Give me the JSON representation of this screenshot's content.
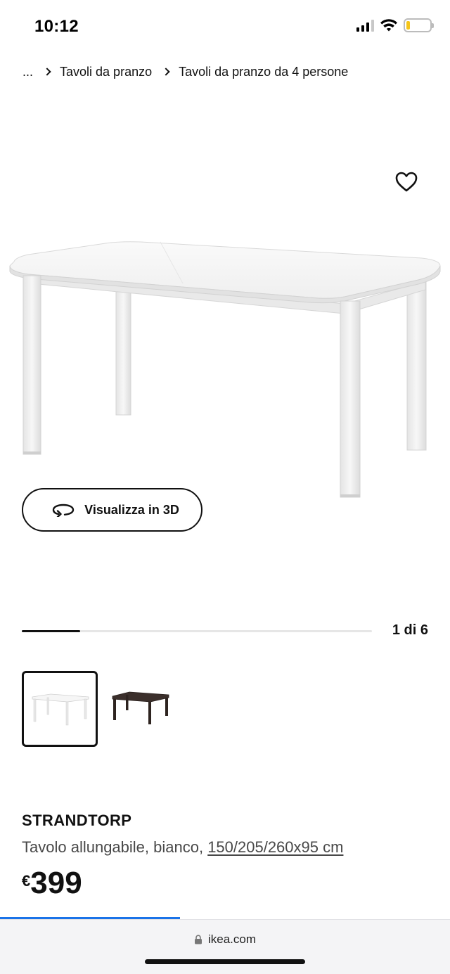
{
  "status_bar": {
    "time": "10:12",
    "icons": [
      "signal-icon",
      "wifi-icon",
      "battery-icon"
    ],
    "signal_bars_active": 3,
    "signal_bars_total": 4,
    "battery_level": 0.15,
    "battery_color": "#f5c518"
  },
  "breadcrumb": {
    "ellipsis": "...",
    "items": [
      "Tavoli da pranzo",
      "Tavoli da pranzo da 4 persone"
    ]
  },
  "gallery": {
    "view_3d_label": "Visualizza in 3D",
    "counter": "1 di 6",
    "progress": 0.1667,
    "thumbnails": [
      {
        "name": "white-table-thumbnail",
        "selected": true
      },
      {
        "name": "black-brown-table-thumbnail",
        "selected": false
      }
    ]
  },
  "product": {
    "name": "STRANDTORP",
    "description": "Tavolo allungabile, bianco, ",
    "dimensions": "150/205/260x95 cm",
    "currency": "€",
    "price": "399"
  },
  "browser": {
    "url": "ikea.com",
    "page_load_progress": 0.4,
    "accent_color": "#1a73e8"
  }
}
